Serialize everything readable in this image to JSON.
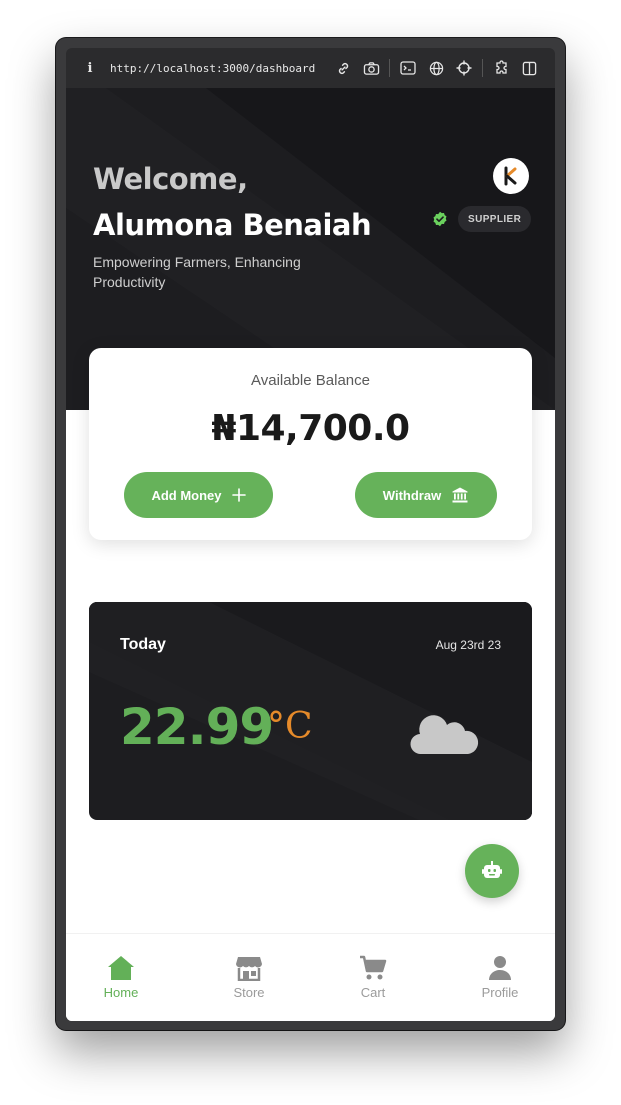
{
  "browser": {
    "url": "http://localhost:3000/dashboard"
  },
  "header": {
    "greeting": "Welcome,",
    "user_name": "Alumona Benaiah",
    "tagline": "Empowering Farmers, Enhancing Productivity",
    "role_badge": "SUPPLIER",
    "avatar_letter": "K"
  },
  "balance": {
    "label": "Available Balance",
    "amount": "₦14,700.0",
    "add_money_label": "Add Money",
    "withdraw_label": "Withdraw"
  },
  "weather": {
    "day_label": "Today",
    "date": "Aug 23rd 23",
    "temperature": "22.99",
    "unit": "°C",
    "condition_icon": "cloud-icon"
  },
  "bottom_nav": {
    "items": [
      {
        "label": "Home",
        "icon": "home-icon",
        "active": true
      },
      {
        "label": "Store",
        "icon": "store-icon",
        "active": false
      },
      {
        "label": "Cart",
        "icon": "cart-icon",
        "active": false
      },
      {
        "label": "Profile",
        "icon": "person-icon",
        "active": false
      }
    ]
  },
  "colors": {
    "brand_green": "#66b25a",
    "dark_bg": "#1d1d20",
    "temperature_unit": "#e58a2a",
    "nav_inactive": "#9b9b9b"
  }
}
